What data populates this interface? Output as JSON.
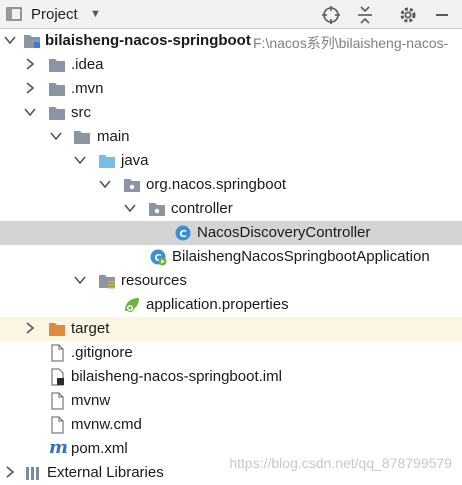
{
  "toolbar": {
    "title": "Project",
    "icons": [
      "project-view-icon",
      "chevron-down-icon",
      "crosshair-locate-icon",
      "collapse-all-icon",
      "gear-icon",
      "hide-minus-icon"
    ]
  },
  "tree": {
    "root": {
      "label": "bilaisheng-nacos-springboot",
      "path": "F:\\nacos系列\\bilaisheng-nacos-"
    },
    "idea": ".idea",
    "mvn": ".mvn",
    "src": "src",
    "main": "main",
    "java": "java",
    "package": "org.nacos.springboot",
    "controller": "controller",
    "controller_class": "NacosDiscoveryController",
    "app_class": "BilaishengNacosSpringbootApplication",
    "resources": "resources",
    "app_properties": "application.properties",
    "target": "target",
    "gitignore": ".gitignore",
    "iml": "bilaisheng-nacos-springboot.iml",
    "mvnw": "mvnw",
    "mvnw_cmd": "mvnw.cmd",
    "pom": "pom.xml",
    "external": "External Libraries"
  },
  "colors": {
    "folder": "#8c96a2",
    "source_folder": "#77bde6",
    "resources_folder": "#8c96a2",
    "target_folder": "#e08a3c",
    "class_icon": "#3a8fd6",
    "spring_leaf": "#6db33f",
    "selected_row": "#d4d4d4",
    "target_row": "#fbf6e3",
    "maven_m": "#2f73c9"
  },
  "watermark": "https://blog.csdn.net/qq_878799579"
}
